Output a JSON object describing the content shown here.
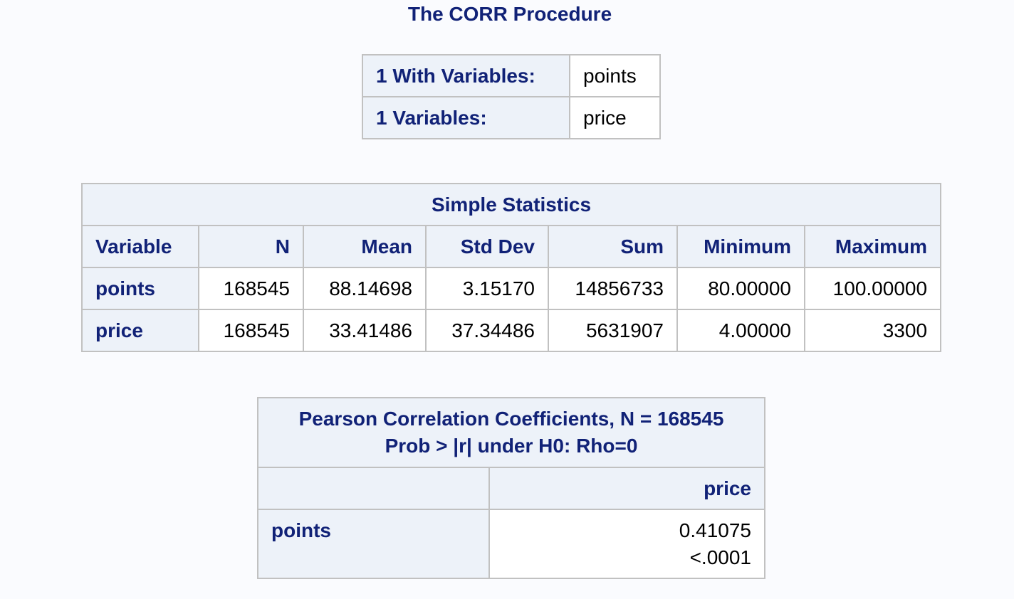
{
  "procedure_title": "The CORR Procedure",
  "variables_info": {
    "rows": [
      {
        "label": "1 With Variables:",
        "value": "points"
      },
      {
        "label": "1 Variables:",
        "value": "price"
      }
    ]
  },
  "simple_statistics": {
    "title": "Simple Statistics",
    "columns": [
      "Variable",
      "N",
      "Mean",
      "Std Dev",
      "Sum",
      "Minimum",
      "Maximum"
    ],
    "rows": [
      {
        "variable": "points",
        "n": "168545",
        "mean": "88.14698",
        "std_dev": "3.15170",
        "sum": "14856733",
        "minimum": "80.00000",
        "maximum": "100.00000"
      },
      {
        "variable": "price",
        "n": "168545",
        "mean": "33.41486",
        "std_dev": "37.34486",
        "sum": "5631907",
        "minimum": "4.00000",
        "maximum": "3300"
      }
    ]
  },
  "pearson": {
    "title_line1": "Pearson Correlation Coefficients, N = 168545",
    "title_line2": "Prob > |r| under H0: Rho=0",
    "column_header": "price",
    "row_label": "points",
    "coefficient": "0.41075",
    "p_value": "<.0001"
  }
}
